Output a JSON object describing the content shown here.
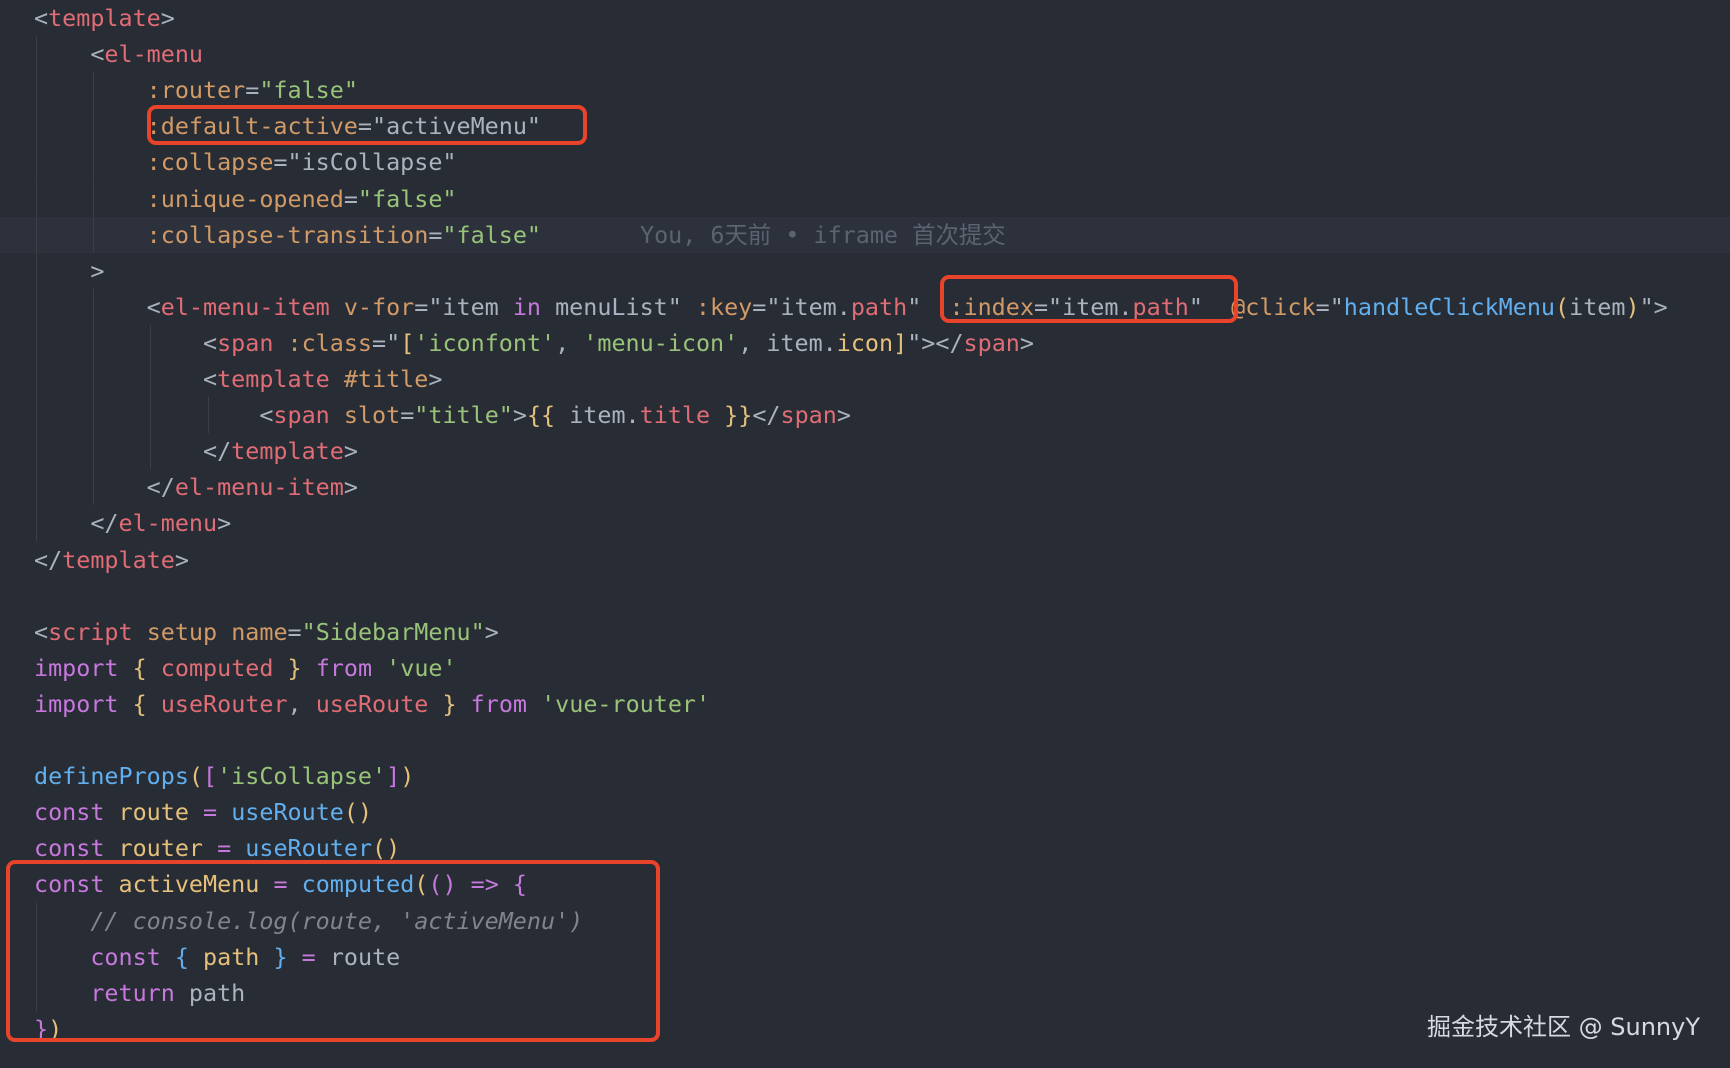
{
  "theme": {
    "background": "#282c34",
    "current_line": "#2c313c",
    "highlight_box": "#e8432b",
    "colors": {
      "p": "#abb2bf",
      "t": "#e06c75",
      "a": "#d19a66",
      "s": "#98c379",
      "k": "#c678dd",
      "f": "#61afef",
      "c": "#7f848e",
      "y": "#e5c07b"
    }
  },
  "code_lines": [
    {
      "tokens": [
        [
          "p",
          "<"
        ],
        [
          "t",
          "template"
        ],
        [
          "p",
          ">"
        ]
      ]
    },
    {
      "tokens": [
        [
          "p",
          "    <"
        ],
        [
          "t",
          "el-menu"
        ]
      ]
    },
    {
      "tokens": [
        [
          "a",
          "        :router"
        ],
        [
          "p",
          "="
        ],
        [
          "s",
          "\"false\""
        ]
      ]
    },
    {
      "tokens": [
        [
          "a",
          "        :default-active"
        ],
        [
          "p",
          "="
        ],
        [
          "p",
          "\"activeMenu\""
        ]
      ]
    },
    {
      "tokens": [
        [
          "a",
          "        :collapse"
        ],
        [
          "p",
          "="
        ],
        [
          "p",
          "\"isCollapse\""
        ]
      ]
    },
    {
      "tokens": [
        [
          "a",
          "        :unique-opened"
        ],
        [
          "p",
          "="
        ],
        [
          "s",
          "\"false\""
        ]
      ]
    },
    {
      "tokens": [
        [
          "a",
          "        :collapse-transition"
        ],
        [
          "p",
          "="
        ],
        [
          "s",
          "\"false\""
        ]
      ],
      "current": true
    },
    {
      "tokens": [
        [
          "p",
          "    >"
        ]
      ]
    },
    {
      "tokens": [
        [
          "p",
          "        <"
        ],
        [
          "t",
          "el-menu-item"
        ],
        [
          "p",
          " "
        ],
        [
          "a",
          "v-for"
        ],
        [
          "p",
          "=\"item "
        ],
        [
          "k",
          "in"
        ],
        [
          "p",
          " menuList\" "
        ],
        [
          "a",
          ":key"
        ],
        [
          "p",
          "=\"item."
        ],
        [
          "t",
          "path"
        ],
        [
          "p",
          "\"  "
        ],
        [
          "a",
          ":index"
        ],
        [
          "p",
          "=\"item."
        ],
        [
          "t",
          "path"
        ],
        [
          "p",
          "\"  "
        ],
        [
          "a",
          "@click"
        ],
        [
          "p",
          "=\""
        ],
        [
          "f",
          "handleClickMenu"
        ],
        [
          "y",
          "("
        ],
        [
          "p",
          "item"
        ],
        [
          "y",
          ")"
        ],
        [
          "p",
          "\">"
        ]
      ]
    },
    {
      "tokens": [
        [
          "p",
          "            <"
        ],
        [
          "t",
          "span"
        ],
        [
          "p",
          " "
        ],
        [
          "a",
          ":class"
        ],
        [
          "p",
          "=\""
        ],
        [
          "y",
          "["
        ],
        [
          "s",
          "'iconfont'"
        ],
        [
          "p",
          ", "
        ],
        [
          "s",
          "'menu-icon'"
        ],
        [
          "p",
          ", item."
        ],
        [
          "y",
          "icon"
        ],
        [
          "y",
          "]"
        ],
        [
          "p",
          "\"></"
        ],
        [
          "t",
          "span"
        ],
        [
          "p",
          ">"
        ]
      ]
    },
    {
      "tokens": [
        [
          "p",
          "            <"
        ],
        [
          "t",
          "template"
        ],
        [
          "p",
          " "
        ],
        [
          "a",
          "#title"
        ],
        [
          "p",
          ">"
        ]
      ]
    },
    {
      "tokens": [
        [
          "p",
          "                <"
        ],
        [
          "t",
          "span"
        ],
        [
          "p",
          " "
        ],
        [
          "a",
          "slot"
        ],
        [
          "p",
          "="
        ],
        [
          "s",
          "\"title\""
        ],
        [
          "p",
          ">"
        ],
        [
          "y",
          "{{"
        ],
        [
          "p",
          " item."
        ],
        [
          "t",
          "title"
        ],
        [
          "p",
          " "
        ],
        [
          "y",
          "}}"
        ],
        [
          "p",
          "</"
        ],
        [
          "t",
          "span"
        ],
        [
          "p",
          ">"
        ]
      ]
    },
    {
      "tokens": [
        [
          "p",
          "            </"
        ],
        [
          "t",
          "template"
        ],
        [
          "p",
          ">"
        ]
      ]
    },
    {
      "tokens": [
        [
          "p",
          "        </"
        ],
        [
          "t",
          "el-menu-item"
        ],
        [
          "p",
          ">"
        ]
      ]
    },
    {
      "tokens": [
        [
          "p",
          "    </"
        ],
        [
          "t",
          "el-menu"
        ],
        [
          "p",
          ">"
        ]
      ]
    },
    {
      "tokens": [
        [
          "p",
          "</"
        ],
        [
          "t",
          "template"
        ],
        [
          "p",
          ">"
        ]
      ]
    },
    {
      "tokens": []
    },
    {
      "tokens": [
        [
          "p",
          "<"
        ],
        [
          "t",
          "script"
        ],
        [
          "p",
          " "
        ],
        [
          "a",
          "setup"
        ],
        [
          "p",
          " "
        ],
        [
          "a",
          "name"
        ],
        [
          "p",
          "="
        ],
        [
          "s",
          "\"SidebarMenu\""
        ],
        [
          "p",
          ">"
        ]
      ]
    },
    {
      "tokens": [
        [
          "k",
          "import"
        ],
        [
          "p",
          " "
        ],
        [
          "y",
          "{"
        ],
        [
          "p",
          " "
        ],
        [
          "t",
          "computed"
        ],
        [
          "p",
          " "
        ],
        [
          "y",
          "}"
        ],
        [
          "p",
          " "
        ],
        [
          "k",
          "from"
        ],
        [
          "p",
          " "
        ],
        [
          "s",
          "'vue'"
        ]
      ]
    },
    {
      "tokens": [
        [
          "k",
          "import"
        ],
        [
          "p",
          " "
        ],
        [
          "y",
          "{"
        ],
        [
          "p",
          " "
        ],
        [
          "t",
          "useRouter"
        ],
        [
          "p",
          ", "
        ],
        [
          "t",
          "useRoute"
        ],
        [
          "p",
          " "
        ],
        [
          "y",
          "}"
        ],
        [
          "p",
          " "
        ],
        [
          "k",
          "from"
        ],
        [
          "p",
          " "
        ],
        [
          "s",
          "'vue-router'"
        ]
      ]
    },
    {
      "tokens": []
    },
    {
      "tokens": [
        [
          "f",
          "defineProps"
        ],
        [
          "y",
          "("
        ],
        [
          "k",
          "["
        ],
        [
          "s",
          "'isCollapse'"
        ],
        [
          "k",
          "]"
        ],
        [
          "y",
          ")"
        ]
      ]
    },
    {
      "tokens": [
        [
          "k",
          "const"
        ],
        [
          "p",
          " "
        ],
        [
          "y",
          "route"
        ],
        [
          "p",
          " "
        ],
        [
          "k",
          "="
        ],
        [
          "p",
          " "
        ],
        [
          "f",
          "useRoute"
        ],
        [
          "y",
          "()"
        ]
      ]
    },
    {
      "tokens": [
        [
          "k",
          "const"
        ],
        [
          "p",
          " "
        ],
        [
          "y",
          "router"
        ],
        [
          "p",
          " "
        ],
        [
          "k",
          "="
        ],
        [
          "p",
          " "
        ],
        [
          "f",
          "useRouter"
        ],
        [
          "y",
          "()"
        ]
      ]
    },
    {
      "tokens": [
        [
          "k",
          "const"
        ],
        [
          "p",
          " "
        ],
        [
          "y",
          "activeMenu"
        ],
        [
          "p",
          " "
        ],
        [
          "k",
          "="
        ],
        [
          "p",
          " "
        ],
        [
          "f",
          "computed"
        ],
        [
          "y",
          "("
        ],
        [
          "k",
          "()"
        ],
        [
          "p",
          " "
        ],
        [
          "k",
          "=>"
        ],
        [
          "p",
          " "
        ],
        [
          "k",
          "{"
        ]
      ]
    },
    {
      "tokens": [
        [
          "c",
          "    // console.log(route, 'activeMenu')"
        ]
      ],
      "italic": true
    },
    {
      "tokens": [
        [
          "k",
          "    const"
        ],
        [
          "p",
          " "
        ],
        [
          "f",
          "{"
        ],
        [
          "p",
          " "
        ],
        [
          "y",
          "path"
        ],
        [
          "p",
          " "
        ],
        [
          "f",
          "}"
        ],
        [
          "p",
          " "
        ],
        [
          "k",
          "="
        ],
        [
          "p",
          " route"
        ]
      ]
    },
    {
      "tokens": [
        [
          "k",
          "    return"
        ],
        [
          "p",
          " path"
        ]
      ]
    },
    {
      "tokens": [
        [
          "k",
          "}"
        ],
        [
          "y",
          ")"
        ]
      ]
    }
  ],
  "blame": "You, 6天前 • iframe 首次提交",
  "watermark": "掘金技术社区 @ SunnyY"
}
